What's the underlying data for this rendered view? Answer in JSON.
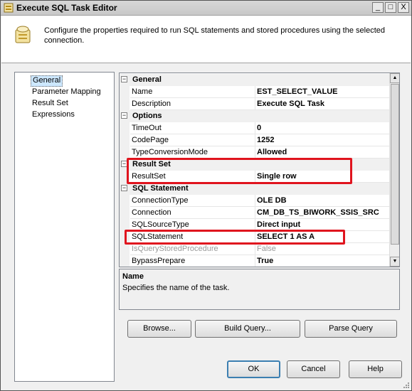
{
  "window": {
    "title": "Execute SQL Task Editor",
    "minimize": "_",
    "maximize": "□",
    "close": "X"
  },
  "header": {
    "description": "Configure the properties required to run SQL statements and stored procedures using the selected connection."
  },
  "nav": {
    "items": [
      {
        "label": "General",
        "selected": true
      },
      {
        "label": "Parameter Mapping",
        "selected": false
      },
      {
        "label": "Result Set",
        "selected": false
      },
      {
        "label": "Expressions",
        "selected": false
      }
    ]
  },
  "grid": {
    "categories": {
      "general": "General",
      "options": "Options",
      "resultset": "Result Set",
      "sql": "SQL Statement"
    },
    "collapse_glyph": "−",
    "props": {
      "name": {
        "label": "Name",
        "value": "EST_SELECT_VALUE"
      },
      "description": {
        "label": "Description",
        "value": "Execute SQL Task"
      },
      "timeout": {
        "label": "TimeOut",
        "value": "0"
      },
      "codepage": {
        "label": "CodePage",
        "value": "1252"
      },
      "typeconv": {
        "label": "TypeConversionMode",
        "value": "Allowed"
      },
      "resultset": {
        "label": "ResultSet",
        "value": "Single row"
      },
      "conntype": {
        "label": "ConnectionType",
        "value": "OLE DB"
      },
      "connection": {
        "label": "Connection",
        "value": "CM_DB_TS_BIWORK_SSIS_SRC"
      },
      "sqlsourcetype": {
        "label": "SQLSourceType",
        "value": "Direct input"
      },
      "sqlstatement": {
        "label": "SQLStatement",
        "value": "SELECT 1 AS A"
      },
      "isquerysp": {
        "label": "IsQueryStoredProcedure",
        "value": "False"
      },
      "bypassprepare": {
        "label": "BypassPrepare",
        "value": "True"
      }
    }
  },
  "description_panel": {
    "title": "Name",
    "text": "Specifies the name of the task."
  },
  "buttons": {
    "browse": "Browse...",
    "build_query": "Build Query...",
    "parse_query": "Parse Query",
    "ok": "OK",
    "cancel": "Cancel",
    "help": "Help"
  },
  "colors": {
    "highlight": "#e0141e",
    "selection": "#cde8ff"
  }
}
